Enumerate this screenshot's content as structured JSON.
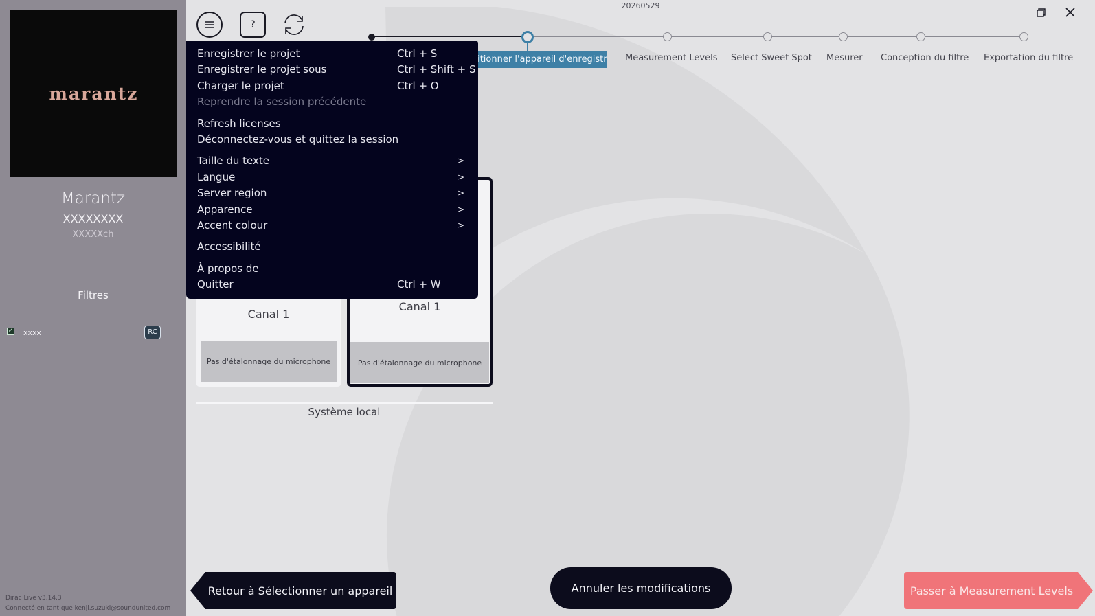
{
  "sidebar": {
    "logo_text": "marantz",
    "brand_name": "Marantz",
    "model": "XXXXXXXX",
    "channels": "XXXXXch",
    "filters_title": "Filtres",
    "filter_item": {
      "name": "xxxx",
      "badge": "RC",
      "checked": true
    },
    "version": "Dirac Live v3.14.3",
    "connected_as": "Connecté en tant que kenji.suzuki@soundunited.com"
  },
  "header": {
    "date": "20260529",
    "help_label": "?"
  },
  "stepper": {
    "active_label": "Positionner l'appareil d'enregistrement",
    "steps": [
      "Measurement Levels",
      "Select Sweet Spot",
      "Mesurer",
      "Conception du filtre",
      "Exportation du filtre"
    ]
  },
  "cards": [
    {
      "channel": "Canal 1",
      "mic_status": "Pas d'étalonnage du microphone"
    },
    {
      "channel": "Canal 1",
      "mic_status": "Pas d'étalonnage du microphone"
    }
  ],
  "local_system_label": "Système local",
  "buttons": {
    "back": "Retour à Sélectionner un appareil",
    "cancel": "Annuler les modifications",
    "next": "Passer à Measurement Levels"
  },
  "menu": {
    "save": "Enregistrer le projet",
    "save_shortcut": "Ctrl + S",
    "save_as": "Enregistrer le projet sous",
    "save_as_shortcut": "Ctrl + Shift + S",
    "load": "Charger le projet",
    "load_shortcut": "Ctrl + O",
    "resume": "Reprendre la session précédente",
    "refresh": "Refresh licenses",
    "logout": "Déconnectez-vous et quittez la session",
    "text_size": "Taille du texte",
    "language": "Langue",
    "server_region": "Server region",
    "appearance": "Apparence",
    "accent": "Accent colour",
    "accessibility": "Accessibilité",
    "about": "À propos de",
    "quit": "Quitter",
    "quit_shortcut": "Ctrl + W",
    "submenu_arrow": ">"
  },
  "colors": {
    "accent": "#3e80a6",
    "next_button": "#f07479",
    "menu_bg": "#04041e",
    "sidebar_bg": "#8e8a93"
  }
}
